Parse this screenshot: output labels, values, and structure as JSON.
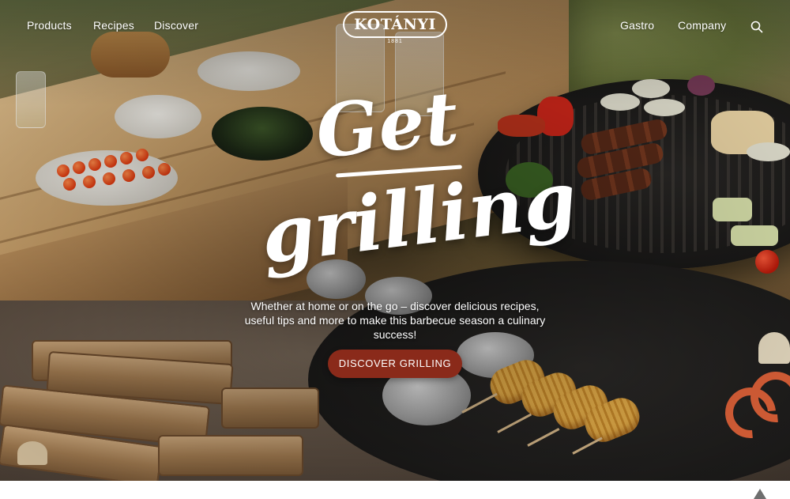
{
  "nav": {
    "left_links": [
      "Products",
      "Recipes",
      "Discover"
    ],
    "right_links": [
      "Gastro",
      "Company"
    ],
    "search_icon": "search-icon"
  },
  "logo": {
    "text": "KOTÁNYI",
    "year": "1881"
  },
  "hero": {
    "headline_line1": "Get",
    "headline_line2": "grilling",
    "subtext": "Whether at home or on the go – discover delicious recipes, useful tips and more to make this barbecue season a culinary success!",
    "cta_label": "DISCOVER GRILLING"
  },
  "colors": {
    "cta_background": "#8a2a1a",
    "text": "#ffffff"
  }
}
